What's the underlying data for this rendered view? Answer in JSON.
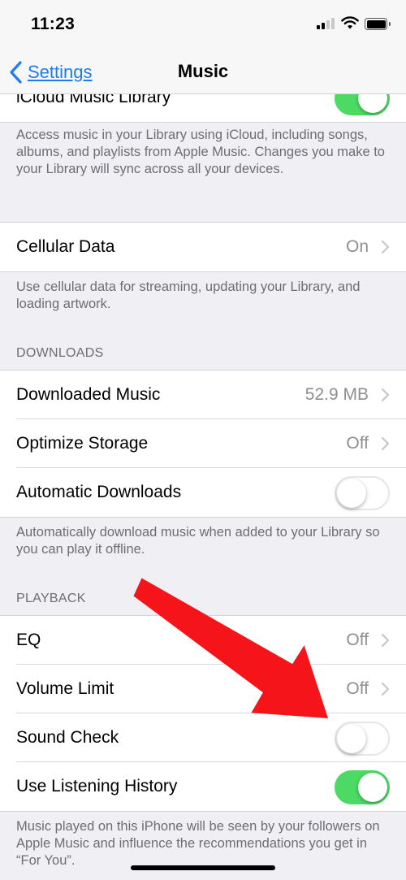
{
  "status_bar": {
    "time": "11:23"
  },
  "nav": {
    "back_label": "Settings",
    "title": "Music"
  },
  "icloud": {
    "label": "iCloud Music Library",
    "toggle_on": true,
    "footer": "Access music in your Library using iCloud, including songs, albums, and playlists from Apple Music. Changes you make to your Library will sync across all your devices."
  },
  "cellular": {
    "label": "Cellular Data",
    "value": "On",
    "footer": "Use cellular data for streaming, updating your Library, and loading artwork."
  },
  "downloads": {
    "header": "DOWNLOADS",
    "downloaded_music": {
      "label": "Downloaded Music",
      "value": "52.9 MB"
    },
    "optimize_storage": {
      "label": "Optimize Storage",
      "value": "Off"
    },
    "automatic_downloads": {
      "label": "Automatic Downloads",
      "toggle_on": false
    },
    "footer": "Automatically download music when added to your Library so you can play it offline."
  },
  "playback": {
    "header": "PLAYBACK",
    "eq": {
      "label": "EQ",
      "value": "Off"
    },
    "volume_limit": {
      "label": "Volume Limit",
      "value": "Off"
    },
    "sound_check": {
      "label": "Sound Check",
      "toggle_on": false
    },
    "listening_history": {
      "label": "Use Listening History",
      "toggle_on": true
    },
    "footer": "Music played on this iPhone will be seen by your followers on Apple Music and influence the recommendations you get in “For You”."
  },
  "colors": {
    "accent": "#1a7cf7",
    "toggle_on": "#4cd964",
    "arrow": "#f4141a",
    "background": "#efeff4"
  }
}
